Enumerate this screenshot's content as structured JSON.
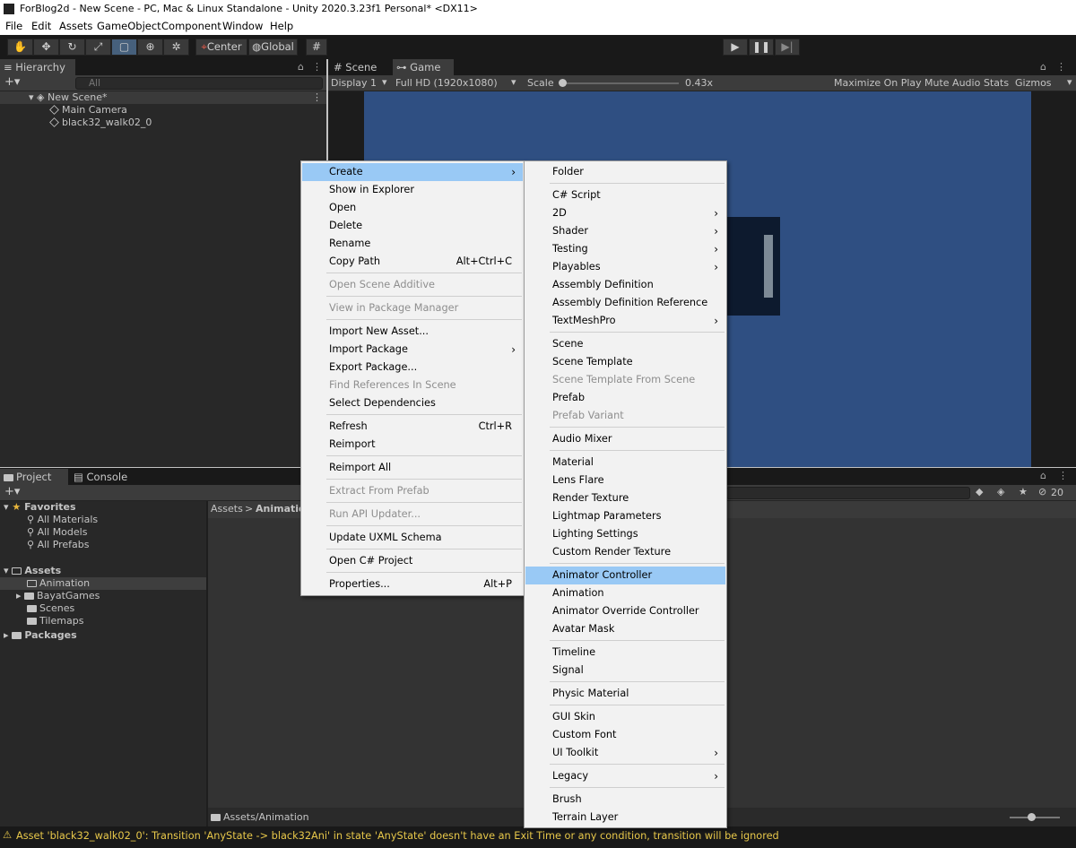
{
  "window": {
    "title": "ForBlog2d - New Scene - PC, Mac & Linux Standalone - Unity 2020.3.23f1 Personal* <DX11>"
  },
  "menubar": [
    "File",
    "Edit",
    "Assets",
    "GameObject",
    "Component",
    "Window",
    "Help"
  ],
  "toolbar": {
    "tools": [
      "hand-tool",
      "move-tool",
      "rotate-tool",
      "scale-tool",
      "rect-tool",
      "transform-tool",
      "custom-tool"
    ],
    "pivot_mode": "Center",
    "pivot_rotation": "Global"
  },
  "hierarchy": {
    "tab_label": "Hierarchy",
    "search_placeholder": "All",
    "scene_name": "New Scene*",
    "items": [
      "Main Camera",
      "black32_walk02_0"
    ]
  },
  "game_view": {
    "tabs": [
      "Scene",
      "Game"
    ],
    "display": "Display 1",
    "resolution": "Full HD (1920x1080)",
    "scale_label": "Scale",
    "scale_value": "0.43x",
    "scale_level": 0.0,
    "options": [
      "Maximize On Play",
      "Mute Audio",
      "Stats",
      "Gizmos"
    ],
    "background_color": "#2f4f82"
  },
  "project": {
    "tabs": [
      "Project",
      "Console"
    ],
    "favorites_label": "Favorites",
    "favorites": [
      "All Materials",
      "All Models",
      "All Prefabs"
    ],
    "assets_label": "Assets",
    "assets_children": [
      "Animation",
      "BayatGames",
      "Scenes",
      "Tilemaps"
    ],
    "packages_label": "Packages",
    "breadcrumb_root": "Assets",
    "breadcrumb_current": "Animation",
    "hidden_count": "20",
    "footer_path": "Assets/Animation"
  },
  "context_menu": {
    "items": [
      {
        "label": "Create",
        "submenu": true,
        "highlighted": true
      },
      {
        "label": "Show in Explorer"
      },
      {
        "label": "Open"
      },
      {
        "label": "Delete"
      },
      {
        "label": "Rename"
      },
      {
        "label": "Copy Path",
        "shortcut": "Alt+Ctrl+C"
      },
      {
        "label": "Open Scene Additive",
        "disabled": true
      },
      {
        "label": "View in Package Manager",
        "disabled": true
      },
      {
        "label": "Import New Asset..."
      },
      {
        "label": "Import Package",
        "submenu": true
      },
      {
        "label": "Export Package..."
      },
      {
        "label": "Find References In Scene",
        "disabled": true
      },
      {
        "label": "Select Dependencies"
      },
      {
        "label": "Refresh",
        "shortcut": "Ctrl+R"
      },
      {
        "label": "Reimport"
      },
      {
        "label": "Reimport All"
      },
      {
        "label": "Extract From Prefab",
        "disabled": true
      },
      {
        "label": "Run API Updater...",
        "disabled": true
      },
      {
        "label": "Update UXML Schema"
      },
      {
        "label": "Open C# Project"
      },
      {
        "label": "Properties...",
        "shortcut": "Alt+P"
      }
    ]
  },
  "create_submenu": {
    "items": [
      {
        "label": "Folder"
      },
      {
        "label": "C# Script"
      },
      {
        "label": "2D",
        "submenu": true
      },
      {
        "label": "Shader",
        "submenu": true
      },
      {
        "label": "Testing",
        "submenu": true
      },
      {
        "label": "Playables",
        "submenu": true
      },
      {
        "label": "Assembly Definition"
      },
      {
        "label": "Assembly Definition Reference"
      },
      {
        "label": "TextMeshPro",
        "submenu": true
      },
      {
        "label": "Scene"
      },
      {
        "label": "Scene Template"
      },
      {
        "label": "Scene Template From Scene",
        "disabled": true
      },
      {
        "label": "Prefab"
      },
      {
        "label": "Prefab Variant",
        "disabled": true
      },
      {
        "label": "Audio Mixer"
      },
      {
        "label": "Material"
      },
      {
        "label": "Lens Flare"
      },
      {
        "label": "Render Texture"
      },
      {
        "label": "Lightmap Parameters"
      },
      {
        "label": "Lighting Settings"
      },
      {
        "label": "Custom Render Texture"
      },
      {
        "label": "Animator Controller",
        "highlighted": true
      },
      {
        "label": "Animation"
      },
      {
        "label": "Animator Override Controller"
      },
      {
        "label": "Avatar Mask"
      },
      {
        "label": "Timeline"
      },
      {
        "label": "Signal"
      },
      {
        "label": "Physic Material"
      },
      {
        "label": "GUI Skin"
      },
      {
        "label": "Custom Font"
      },
      {
        "label": "UI Toolkit",
        "submenu": true
      },
      {
        "label": "Legacy",
        "submenu": true
      },
      {
        "label": "Brush"
      },
      {
        "label": "Terrain Layer"
      }
    ]
  },
  "status": {
    "message": "Asset 'black32_walk02_0': Transition 'AnyState -> black32Ani' in state 'AnyState' doesn't have an Exit Time or any condition, transition will be ignored",
    "warning_color": "#e8c84a"
  }
}
